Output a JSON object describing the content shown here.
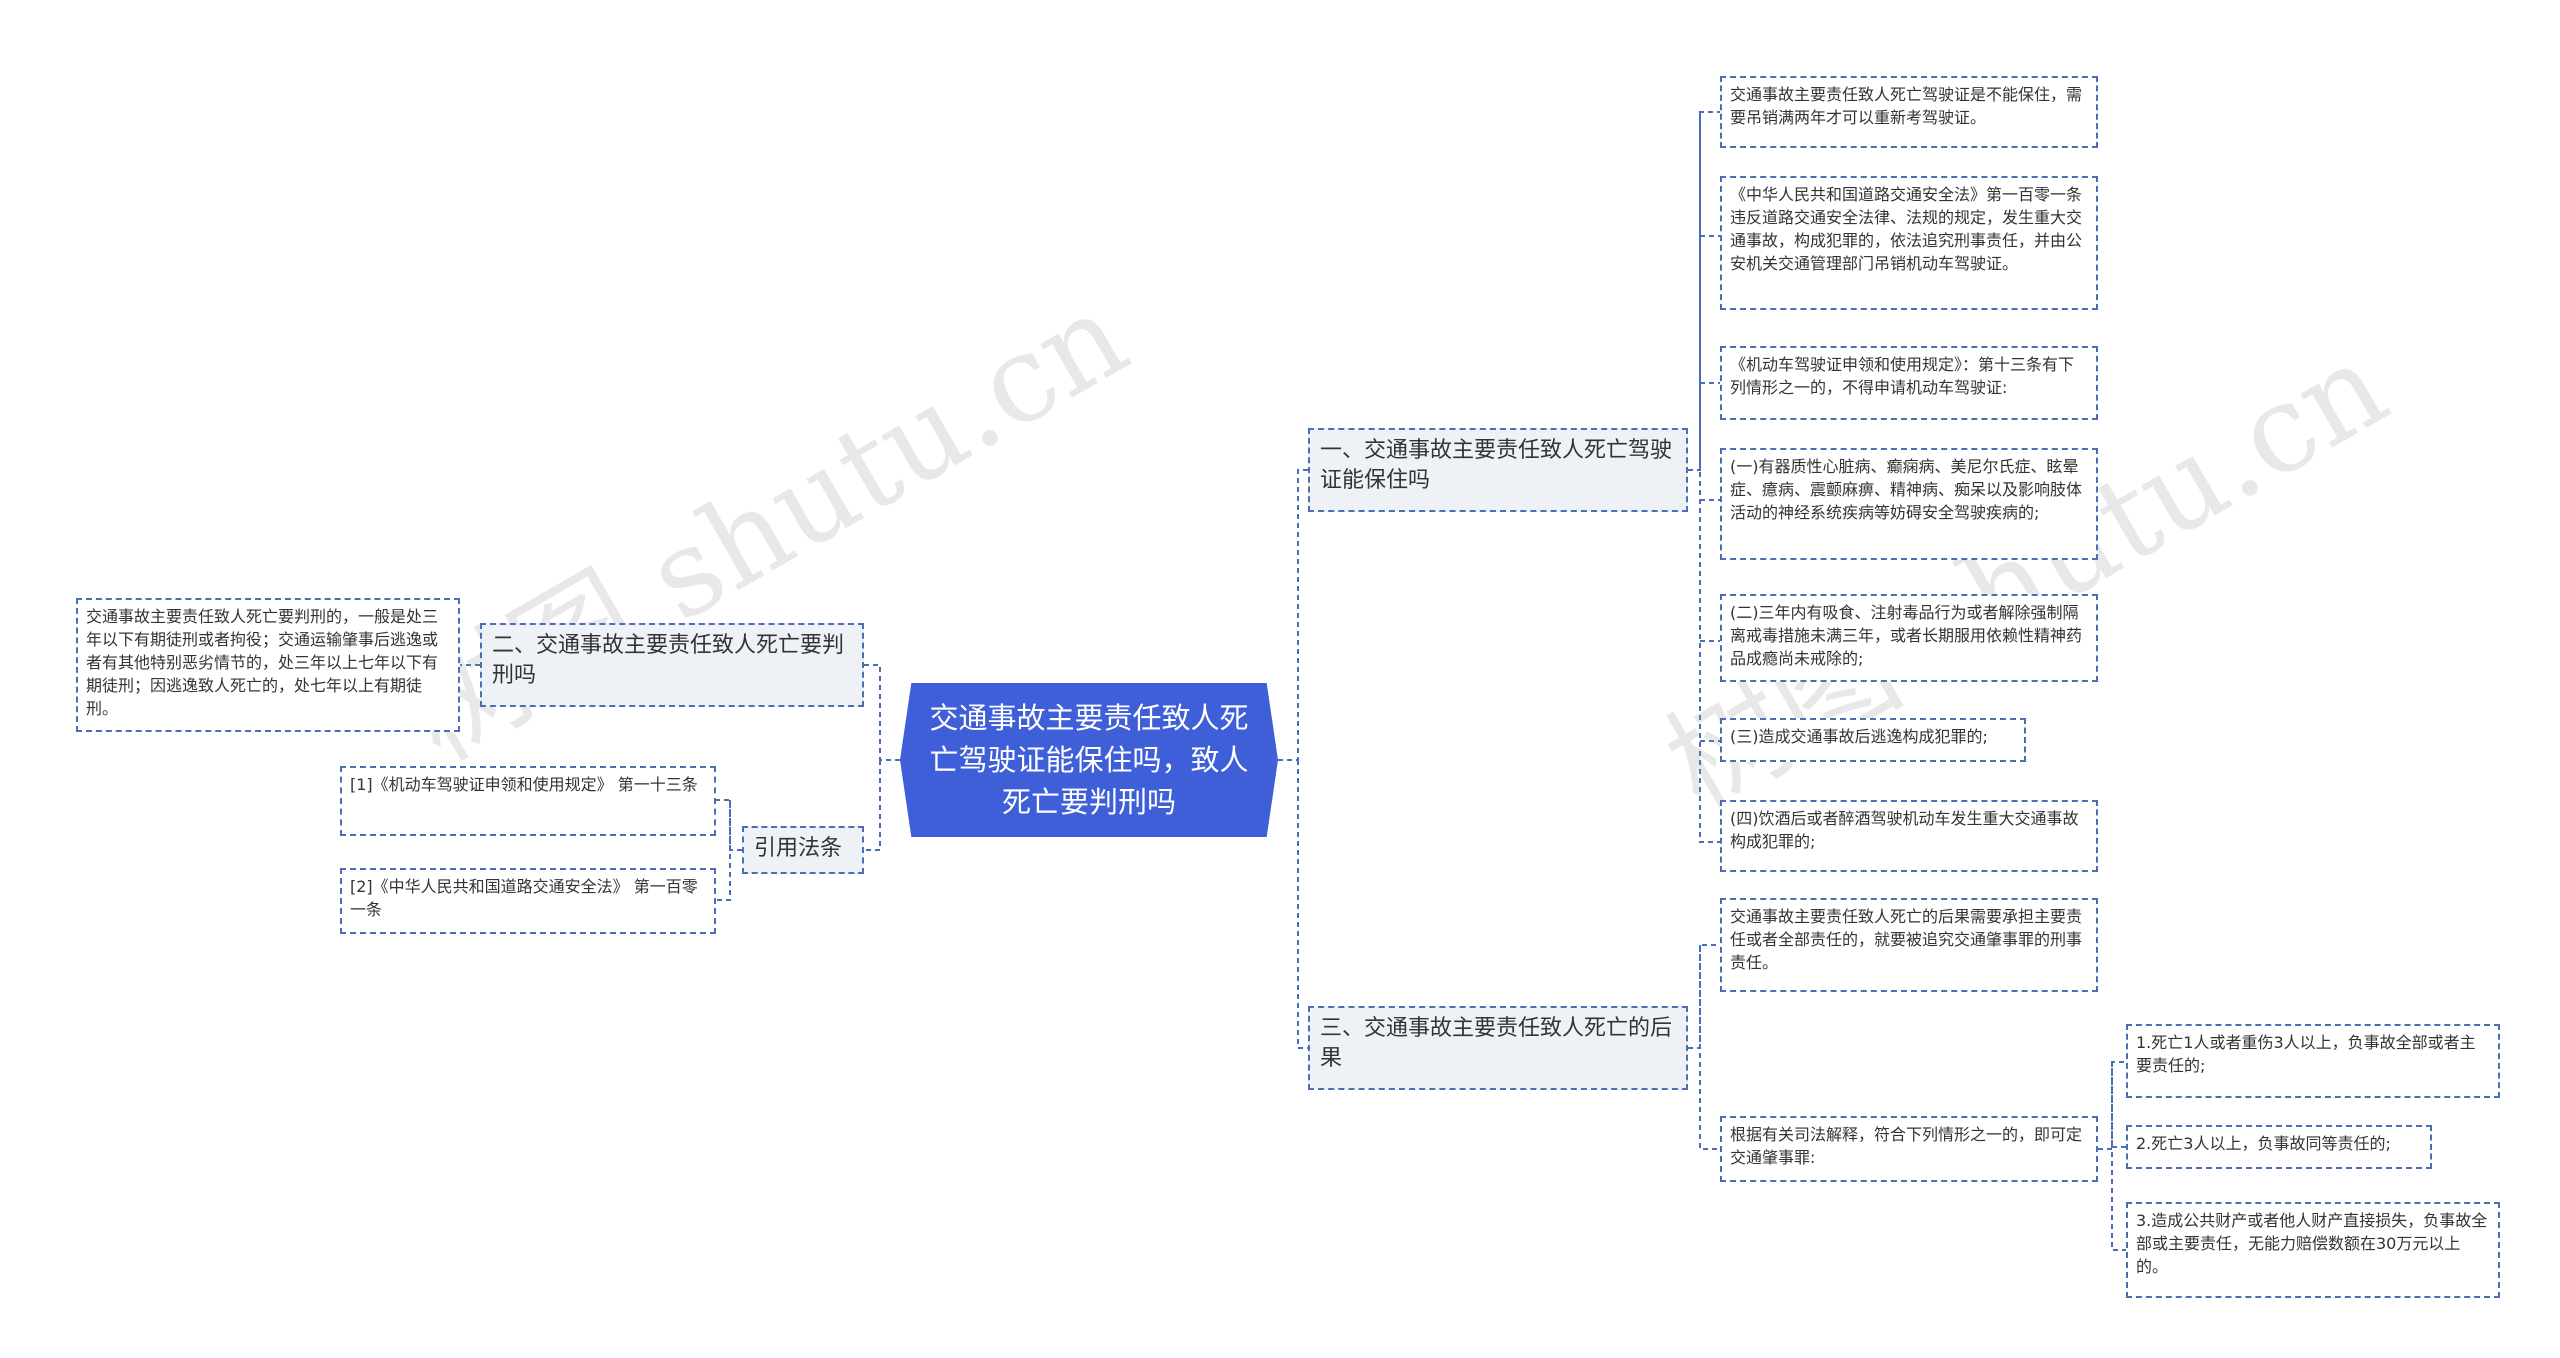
{
  "root": {
    "title": "交通事故主要责任致人死亡驾驶证能保住吗，致人死亡要判刑吗"
  },
  "branches": {
    "b1": {
      "label": "一、交通事故主要责任致人死亡驾驶证能保住吗"
    },
    "b2": {
      "label": "二、交通事故主要责任致人死亡要判刑吗"
    },
    "b3": {
      "label": "三、交通事故主要责任致人死亡的后果"
    },
    "refs": {
      "label": "引用法条"
    }
  },
  "b1_children": [
    "交通事故主要责任致人死亡驾驶证是不能保住，需要吊销满两年才可以重新考驾驶证。",
    "《中华人民共和国道路交通安全法》第一百零一条 违反道路交通安全法律、法规的规定，发生重大交通事故，构成犯罪的，依法追究刑事责任，并由公安机关交通管理部门吊销机动车驾驶证。",
    "《机动车驾驶证申领和使用规定》：第十三条有下列情形之一的，不得申请机动车驾驶证:",
    "(一)有器质性心脏病、癫痫病、美尼尔氏症、眩晕症、癔病、震颤麻痹、精神病、痴呆以及影响肢体活动的神经系统疾病等妨碍安全驾驶疾病的;",
    "(二)三年内有吸食、注射毒品行为或者解除强制隔离戒毒措施未满三年，或者长期服用依赖性精神药品成瘾尚未戒除的;",
    "(三)造成交通事故后逃逸构成犯罪的;",
    "(四)饮酒后或者醉酒驾驶机动车发生重大交通事故构成犯罪的;"
  ],
  "b2_children": [
    "交通事故主要责任致人死亡要判刑的，一般是处三年以下有期徒刑或者拘役；交通运输肇事后逃逸或者有其他特别恶劣情节的，处三年以上七年以下有期徒刑；因逃逸致人死亡的，处七年以上有期徒刑。"
  ],
  "refs_children": [
    "[1]《机动车驾驶证申领和使用规定》 第一十三条",
    "[2]《中华人民共和国道路交通安全法》 第一百零一条"
  ],
  "b3_children": [
    "交通事故主要责任致人死亡的后果需要承担主要责任或者全部责任的，就要被追究交通肇事罪的刑事责任。",
    "根据有关司法解释，符合下列情形之一的，即可定交通肇事罪:"
  ],
  "b3_sub_children": [
    "1.死亡1人或者重伤3人以上，负事故全部或者主要责任的;",
    "2.死亡3人以上，负事故同等责任的;",
    "3.造成公共财产或者他人财产直接损失，负事故全部或主要责任，无能力赔偿数额在30万元以上的。"
  ],
  "watermarks": [
    "树图 shutu.cn",
    "树图 shutu.cn"
  ],
  "colors": {
    "root_fill": "#3f5fd8",
    "connector": "#4a6fb5",
    "branch_fill": "#eef2f6"
  }
}
